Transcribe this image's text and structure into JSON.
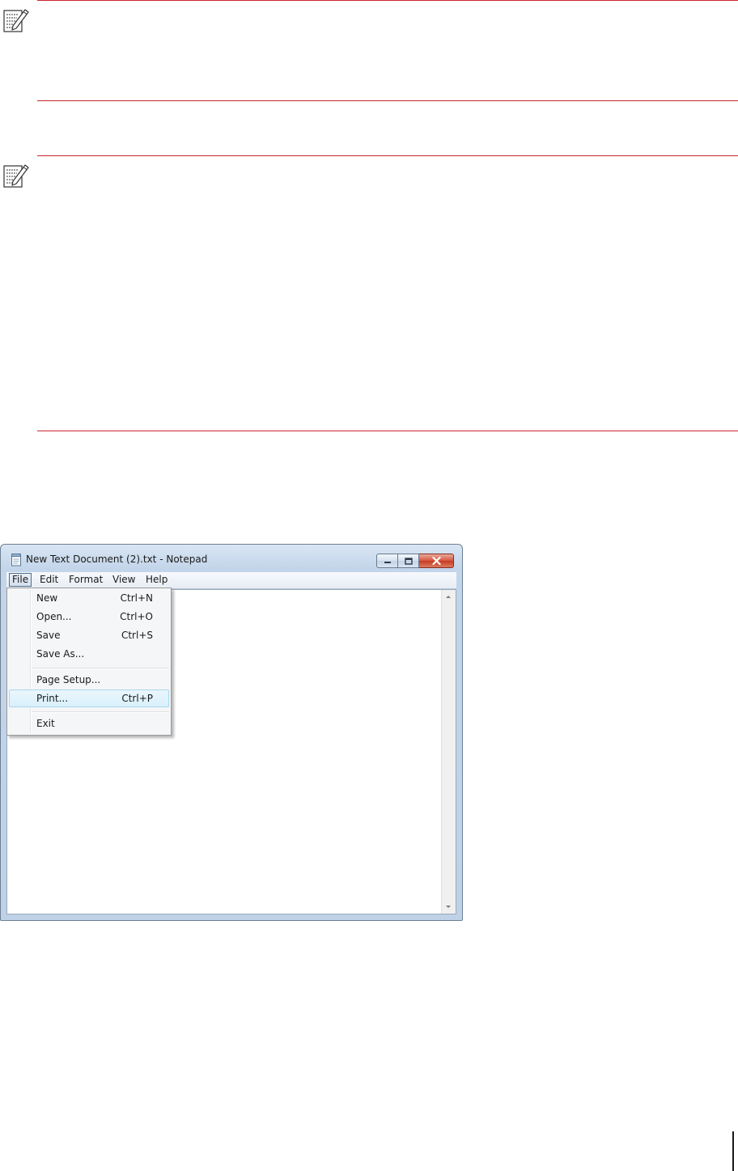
{
  "icons": {
    "note": "note-pencil-icon",
    "app": "notepad-icon",
    "minimize": "minimize-icon",
    "maximize": "maximize-icon",
    "close": "close-icon",
    "scroll_up": "scroll-up-icon",
    "scroll_down": "scroll-down-icon"
  },
  "colors": {
    "rule": "#c9262c",
    "close_button": "#c53a22",
    "menu_highlight": "#d9f0fc"
  },
  "notepad": {
    "title": "New Text Document (2).txt - Notepad",
    "menu": [
      "File",
      "Edit",
      "Format",
      "View",
      "Help"
    ],
    "active_menu": "File",
    "file_menu": {
      "group1": [
        {
          "label": "New",
          "shortcut": "Ctrl+N"
        },
        {
          "label": "Open...",
          "shortcut": "Ctrl+O"
        },
        {
          "label": "Save",
          "shortcut": "Ctrl+S"
        },
        {
          "label": "Save As...",
          "shortcut": ""
        }
      ],
      "group2": [
        {
          "label": "Page Setup...",
          "shortcut": ""
        },
        {
          "label": "Print...",
          "shortcut": "Ctrl+P"
        }
      ],
      "group3": [
        {
          "label": "Exit",
          "shortcut": ""
        }
      ],
      "highlighted": "Print..."
    }
  }
}
